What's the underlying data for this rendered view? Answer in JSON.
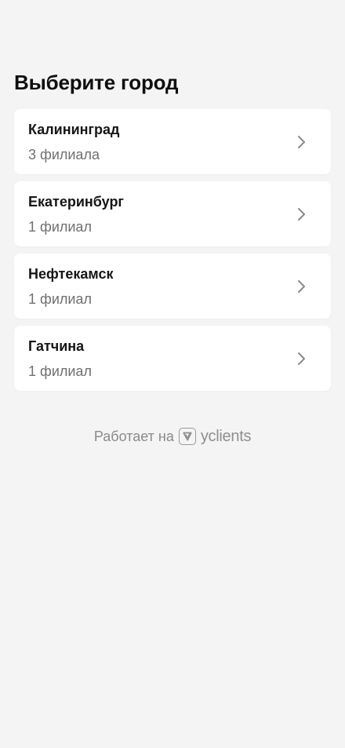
{
  "page": {
    "title": "Выберите город"
  },
  "cities": [
    {
      "name": "Калининград",
      "branches": "3 филиала"
    },
    {
      "name": "Екатеринбург",
      "branches": "1 филиал"
    },
    {
      "name": "Нефтекамск",
      "branches": "1 филиал"
    },
    {
      "name": "Гатчина",
      "branches": "1 филиал"
    }
  ],
  "footer": {
    "powered_text": "Работает на",
    "brand_name": "yclients"
  },
  "icons": {
    "chevron": "chevron-right-icon",
    "brand": "yclients-logo-icon"
  },
  "colors": {
    "background": "#f4f4f4",
    "card": "#ffffff",
    "title": "#0f0f0f",
    "secondary_text": "#707070",
    "chevron": "#8a8a8a",
    "footer_text": "#8a8a8a"
  }
}
